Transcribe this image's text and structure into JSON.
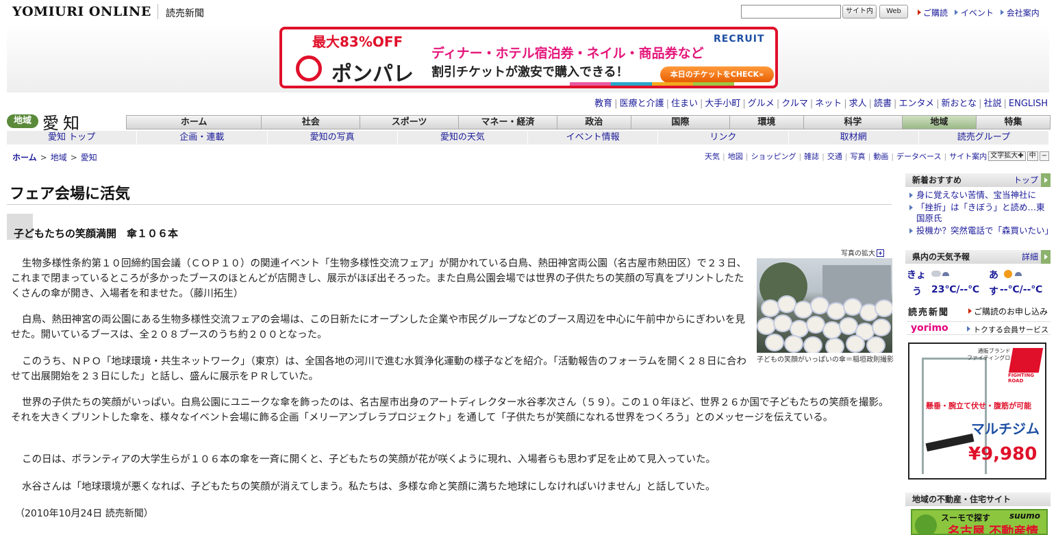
{
  "header": {
    "brand": "YOMIURI ONLINE",
    "brand_jp": "読売新聞",
    "search_placeholder": "",
    "search_site_label": "サイト内",
    "search_web_label": "Web",
    "links": [
      "ご購読",
      "イベント",
      "会社案内"
    ]
  },
  "ad_banner": {
    "discount": "最大83%OFF",
    "logo": "ポンパレ",
    "line1": "ディナー・ホテル宿泊券・ネイル・商品券など",
    "line2": "割引チケットが激安で購入できる！",
    "sponsor": "RECRUIT",
    "cta": "本日のチケットをCHECK»",
    "stripe_colors": [
      "#ffffff",
      "#ffffff",
      "#ffffff",
      "#ffffff",
      "#ffffff",
      "#ffffff",
      "#ffffff",
      "#e85aa0",
      "#27a5c9",
      "#f2a91e",
      "#9cc843",
      "#ffffff"
    ]
  },
  "category_links": [
    "教育",
    "医療と介護",
    "住まい",
    "大手小町",
    "グルメ",
    "クルマ",
    "ネット",
    "求人",
    "読書",
    "エンタメ",
    "新おとな",
    "社説",
    "ENGLISH"
  ],
  "region": {
    "badge": "地域",
    "name": "愛知"
  },
  "main_nav": [
    {
      "label": "ホーム",
      "flex": 2.2
    },
    {
      "label": "社会",
      "flex": 1.6
    },
    {
      "label": "スポーツ",
      "flex": 1.6
    },
    {
      "label": "マネー・経済",
      "flex": 1.6
    },
    {
      "label": "政治",
      "flex": 1.2
    },
    {
      "label": "国際",
      "flex": 1.6
    },
    {
      "label": "環境",
      "flex": 1.2
    },
    {
      "label": "科学",
      "flex": 1.6
    },
    {
      "label": "地域",
      "flex": 1.2,
      "active": true
    },
    {
      "label": "特集",
      "flex": 1.2
    }
  ],
  "sub_nav": [
    "愛知 トップ",
    "企画・連載",
    "愛知の写真",
    "愛知の天気",
    "イベント情報",
    "リンク",
    "取材網",
    "読売グループ"
  ],
  "breadcrumb": [
    "ホーム",
    "地域",
    "愛知"
  ],
  "utils": [
    "天気",
    "地図",
    "ショッピング",
    "雑誌",
    "交通",
    "写真",
    "動画",
    "データベース",
    "サイト案内"
  ],
  "font_controls": {
    "label": "文字拡大",
    "mid": "中",
    "minus": "−"
  },
  "article": {
    "headline": "フェア会場に活気",
    "subhead": "子どもたちの笑顔満開　傘１０６本",
    "paragraphs": [
      "生物多様性条約第１０回締約国会議（ＣＯＰ１０）の関連イベント「生物多様性交流フェア」が開かれている白鳥、熱田神宮両公園（名古屋市熱田区）で２３日、これまで閉まっているところが多かったブースのほとんどが店開きし、展示がほぼ出そろった。また白鳥公園会場では世界の子供たちの笑顔の写真をプリントしたたくさんの傘が開き、入場者を和ませた。（藤川拓生）",
      "白鳥、熱田神宮の両公園にある生物多様性交流フェアの会場は、この日新たにオープンした企業や市民グループなどのブース周辺を中心に午前中からにぎわいを見せた。開いているブースは、全２０８ブースのうち約２００となった。",
      "このうち、ＮＰＯ「地球環境・共生ネットワーク」（東京）は、全国各地の河川で進む水質浄化運動の様子などを紹介。「活動報告のフォーラムを開く２８日に合わせて出展開始を２３日にした」と話し、盛んに展示をＰＲしていた。",
      "世界の子供たちの笑顔がいっぱい。白鳥公園にユニークな傘を飾ったのは、名古屋市出身のアートディレクター水谷孝次さん（５９）。この１０年ほど、世界２６か国で子どもたちの笑顔を撮影。それを大きくプリントした傘を、様々なイベント会場に飾る企画「メリーアンブレラプロジェクト」を通して「子供たちが笑顔になれる世界をつくろう」とのメッセージを伝えている。",
      "この日は、ボランティアの大学生らが１０６本の傘を一斉に開くと、子どもたちの笑顔が花が咲くように現れ、入場者らも思わず足を止めて見入っていた。",
      "水谷さんは「地球環境が悪くなれば、子どもたちの笑顔が消えてしまう。私たちは、多様な命と笑顔に満ちた地球にしなければいけません」と話していた。"
    ],
    "dateline": "（2010年10月24日  読売新聞）",
    "photo_enlarge": "写真の拡大",
    "photo_caption": "子どもの笑顔がいっぱいの傘＝稲垣政則撮影"
  },
  "sidebar": {
    "news_title": "新着おすすめ",
    "news_more": "トップ",
    "news_items": [
      "身に覚えない苦情、宝当神社に",
      "「挫折」は「きぼう」と読め…東国原氏",
      "投機か？突然電話で「森買いたい」"
    ],
    "weather_title": "県内の天気予報",
    "weather_more": "詳細",
    "weather_today_k1": "きょ",
    "weather_today_k2": "う",
    "weather_today_temp": "23℃/--℃",
    "weather_tom_k1": "あ",
    "weather_tom_k2": "す",
    "weather_tom_temp": "--℃/--℃",
    "yomiuri_logo": "読売新聞",
    "yomiuri_link": "ご購読のお申し込み",
    "yorimo_logo": "yorimo",
    "yorimo_link": "トクする会員サービス",
    "side_ad": {
      "brand_line": "通販ブランド\nファイティングロード",
      "brand": "FIGHTING ROAD",
      "tagline": "懸垂・腕立て伏せ・腹筋が可能",
      "product": "マルチジム",
      "price": "¥9,980"
    },
    "estate_title": "地域の不動産・住宅サイト",
    "suumo_line1": "スーモで探す",
    "suumo_brand": "suumo",
    "suumo_line2": "名古屋 不動産情報"
  }
}
